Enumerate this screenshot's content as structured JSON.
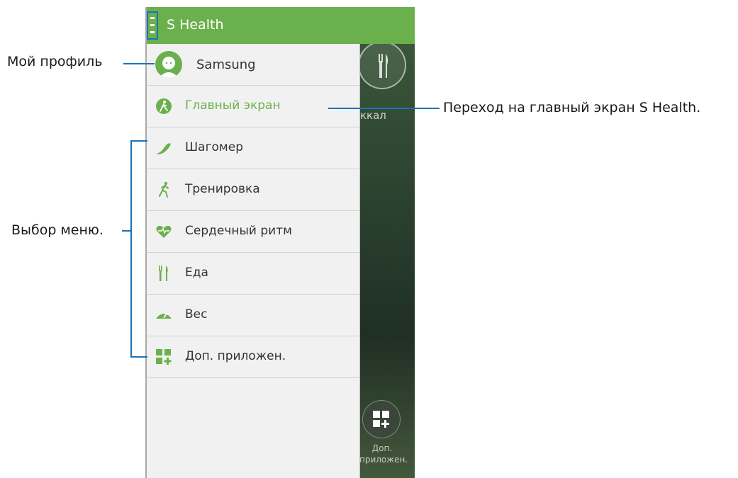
{
  "app": {
    "title": "S Health"
  },
  "header": {
    "menu_icon": "menu-icon",
    "background_color": "#6ab04c"
  },
  "drawer": {
    "profile": {
      "name": "Samsung",
      "icon": "avatar-icon"
    },
    "home": {
      "label": "Главный экран",
      "icon": "home-runner-icon",
      "color": "#6ab04c"
    },
    "items": [
      {
        "label": "Шагомер",
        "icon": "shoe-icon"
      },
      {
        "label": "Тренировка",
        "icon": "runner-icon"
      },
      {
        "label": "Сердечный ритм",
        "icon": "heart-icon"
      },
      {
        "label": "Еда",
        "icon": "fork-knife-icon"
      },
      {
        "label": "Вес",
        "icon": "scale-icon"
      },
      {
        "label": "Доп. приложен.",
        "icon": "apps-plus-icon"
      }
    ]
  },
  "background": {
    "kcal_label": "ккал",
    "apps_label_line1": "Доп.",
    "apps_label_line2": "приложен."
  },
  "callouts": {
    "profile": "Мой профиль",
    "home": "Переход на главный экран S Health.",
    "menu": "Выбор меню."
  },
  "accent_color": "#1a73b8"
}
